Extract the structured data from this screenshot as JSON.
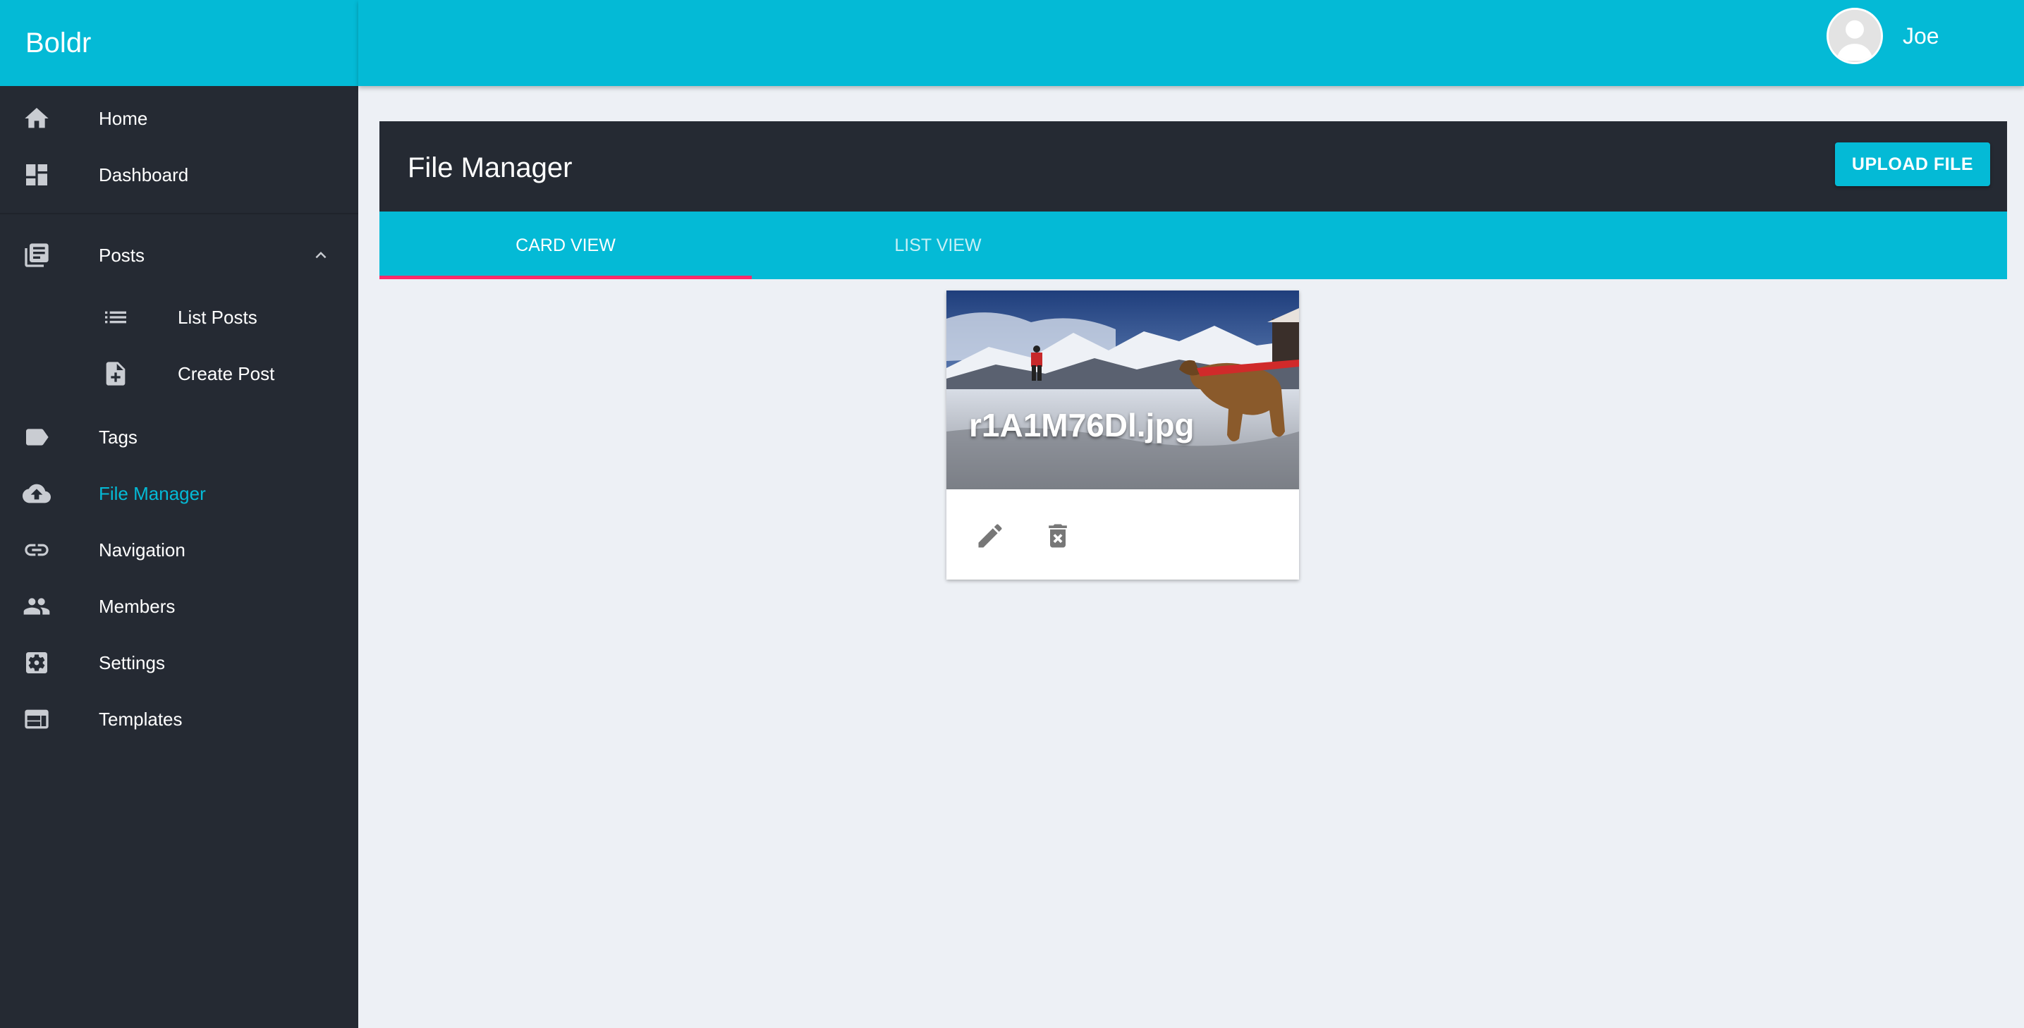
{
  "app": {
    "brand": "Boldr"
  },
  "user": {
    "name": "Joe"
  },
  "sidebar": {
    "items": [
      {
        "label": "Home",
        "icon": "home-icon"
      },
      {
        "label": "Dashboard",
        "icon": "dashboard-icon"
      },
      {
        "label": "Posts",
        "icon": "posts-icon",
        "expanded": true
      },
      {
        "label": "List Posts",
        "icon": "list-icon"
      },
      {
        "label": "Create Post",
        "icon": "note-add-icon"
      },
      {
        "label": "Tags",
        "icon": "tag-icon"
      },
      {
        "label": "File Manager",
        "icon": "cloud-upload-icon",
        "active": true
      },
      {
        "label": "Navigation",
        "icon": "link-icon"
      },
      {
        "label": "Members",
        "icon": "people-icon"
      },
      {
        "label": "Settings",
        "icon": "settings-icon"
      },
      {
        "label": "Templates",
        "icon": "web-icon"
      }
    ]
  },
  "page": {
    "title": "File Manager",
    "upload_label": "UPLOAD FILE",
    "tabs": [
      {
        "label": "CARD VIEW",
        "active": true
      },
      {
        "label": "LIST VIEW",
        "active": false
      }
    ]
  },
  "files": [
    {
      "name": "r1A1M76Dl.jpg"
    }
  ],
  "colors": {
    "accent": "#04bad6",
    "sidebar_bg": "#252a33",
    "content_bg": "#edf0f5",
    "tab_indicator": "#ff2a6a"
  }
}
